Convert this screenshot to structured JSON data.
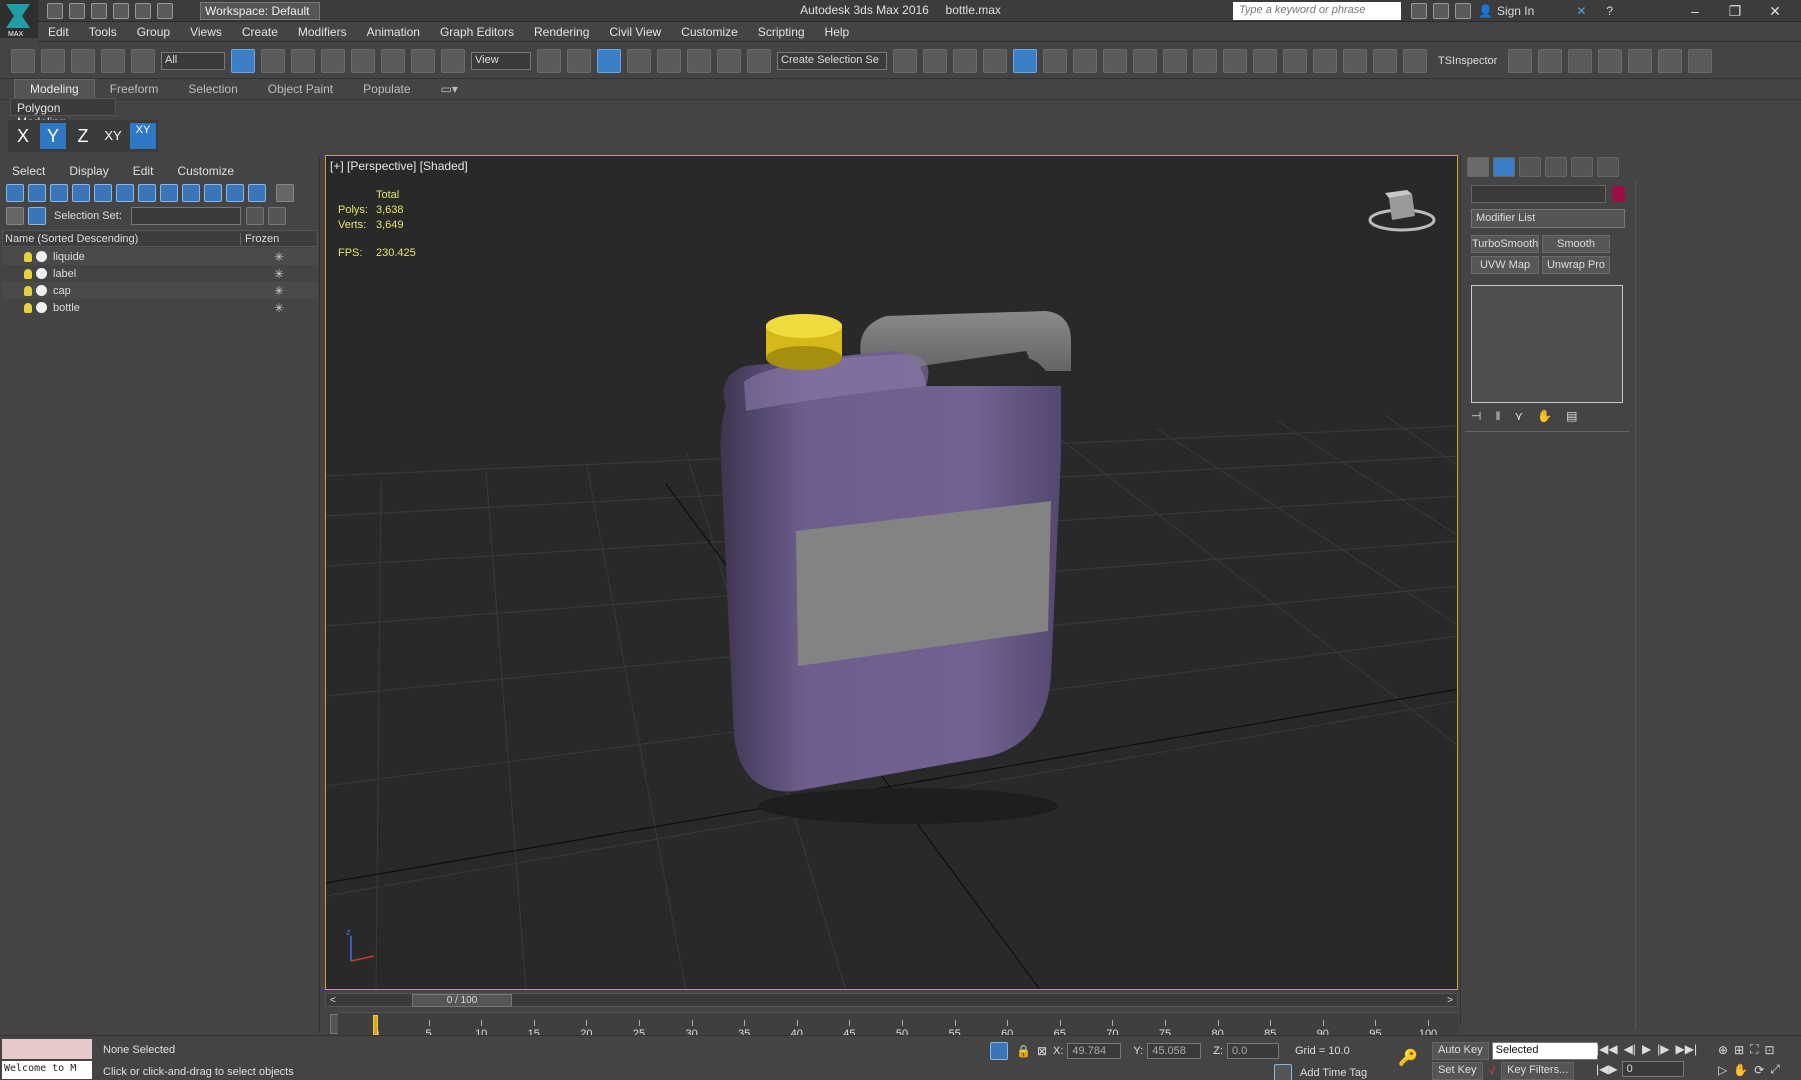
{
  "window": {
    "title": "Autodesk 3ds Max 2016",
    "file": "bottle.max",
    "workspace": "Workspace: Default",
    "search_placeholder": "Type a keyword or phrase",
    "sign_in": "Sign In",
    "logo_text": "MAX"
  },
  "menus": [
    "Edit",
    "Tools",
    "Group",
    "Views",
    "Create",
    "Modifiers",
    "Animation",
    "Graph Editors",
    "Rendering",
    "Civil View",
    "Customize",
    "Scripting",
    "Help"
  ],
  "toolbar": {
    "selection_filter": "All",
    "ref_coord": "View",
    "create_selection_set": "Create Selection Se",
    "tsinspector": "TSInspector"
  },
  "ribbon": {
    "tabs": [
      "Modeling",
      "Freeform",
      "Selection",
      "Object Paint",
      "Populate"
    ],
    "active": "Modeling",
    "panel_label": "Polygon Modeling"
  },
  "axis_constraints": [
    "X",
    "Y",
    "Z",
    "XY",
    "XY"
  ],
  "scene_explorer": {
    "menus": [
      "Select",
      "Display",
      "Edit",
      "Customize"
    ],
    "selection_set_label": "Selection Set:",
    "column_name": "Name (Sorted Descending)",
    "column_frozen": "Frozen",
    "objects": [
      "liquide",
      "label",
      "cap",
      "bottle"
    ]
  },
  "viewport": {
    "label": "[+] [Perspective] [Shaded]",
    "stats_total": "Total",
    "polys_label": "Polys:",
    "polys": "3,638",
    "verts_label": "Verts:",
    "verts": "3,649",
    "fps_label": "FPS:",
    "fps": "230.425",
    "colors": {
      "jug": "#6e5e8e",
      "cap": "#e3c81f",
      "label": "#838383"
    }
  },
  "timeline": {
    "frame": "0 / 100",
    "ticks": [
      "0",
      "5",
      "10",
      "15",
      "20",
      "25",
      "30",
      "35",
      "40",
      "45",
      "50",
      "55",
      "60",
      "65",
      "70",
      "75",
      "80",
      "85",
      "90",
      "95",
      "100"
    ]
  },
  "command_panel": {
    "modifier_list": "Modifier List",
    "buttons": [
      "TurboSmooth",
      "Smooth",
      "UVW Map",
      "Unwrap Pro"
    ],
    "color_swatch": "#9a0f47"
  },
  "status": {
    "welcome": "Welcome to M",
    "selection": "None Selected",
    "prompt": "Click or click-and-drag to select objects",
    "x_label": "X:",
    "x": "49.784",
    "y_label": "Y:",
    "y": "45.058",
    "z_label": "Z:",
    "z": "0.0",
    "grid": "Grid = 10.0",
    "add_time_tag": "Add Time Tag",
    "auto_key": "Auto Key",
    "set_key": "Set Key",
    "key_mode": "Selected",
    "key_filters": "Key Filters...",
    "current_frame": "0"
  }
}
